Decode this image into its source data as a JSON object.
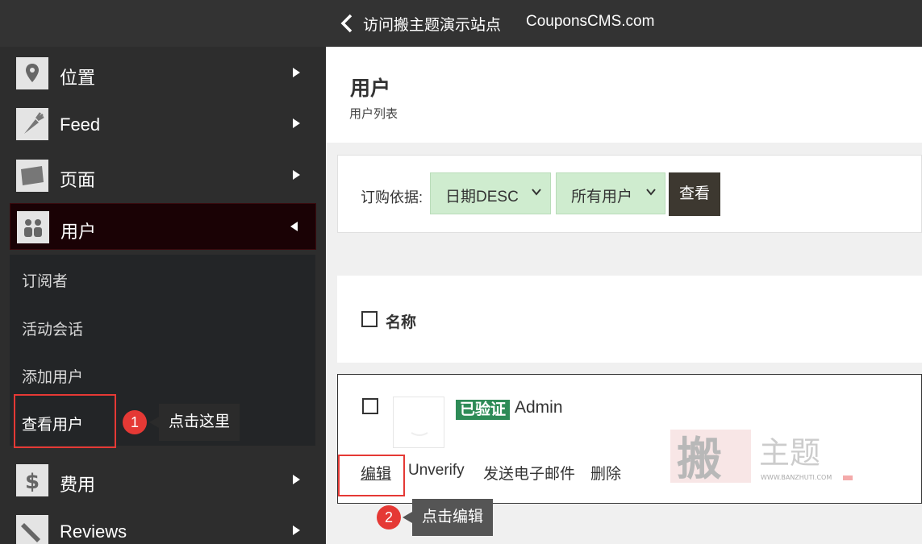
{
  "topbar": {
    "visit_demo": "访问搬主题演示站点",
    "domain": "CouponsCMS.com"
  },
  "sidebar": {
    "items": [
      {
        "label": "位置",
        "icon": "map-pin-icon"
      },
      {
        "label": "Feed",
        "icon": "carrot-icon"
      },
      {
        "label": "页面",
        "icon": "pages-icon"
      },
      {
        "label": "用户",
        "icon": "users-icon"
      },
      {
        "label": "费用",
        "icon": "dollar-icon"
      },
      {
        "label": "Reviews",
        "icon": "pencil-icon"
      }
    ],
    "submenu": [
      "订阅者",
      "活动会话",
      "添加用户",
      "查看用户"
    ]
  },
  "annotations": {
    "step1_num": "1",
    "step1_text": "点击这里",
    "step2_num": "2",
    "step2_text": "点击编辑"
  },
  "page": {
    "title": "用户",
    "subtitle": "用户列表"
  },
  "filter": {
    "label": "订购依据:",
    "order_value": "日期DESC",
    "users_value": "所有用户",
    "view_label": "查看"
  },
  "table": {
    "header_name": "名称",
    "rows": [
      {
        "status": "已验证",
        "name": "Admin",
        "actions": [
          "编辑",
          "Unverify",
          "发送电子邮件",
          "删除"
        ]
      }
    ]
  },
  "watermark": {
    "main": "搬主题",
    "url": "WWW.BANZHUTI.COM"
  },
  "colors": {
    "topbar": "#333333",
    "sidebar": "#2d2d2d",
    "active_item": "#1a0205",
    "select_bg": "#cfeccf",
    "verified": "#2e8b57",
    "annotation_red": "#e53935"
  }
}
